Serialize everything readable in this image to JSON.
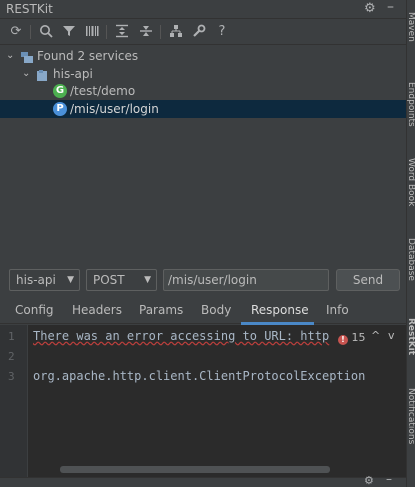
{
  "window": {
    "title": "RESTKit"
  },
  "toolbar": {
    "icons": [
      "refresh-icon",
      "search-icon",
      "filter-icon",
      "barcode-icon",
      "expand-all-icon",
      "collapse-all-icon",
      "sitemap-icon",
      "settings-wrench-icon",
      "help-icon"
    ],
    "help_glyph": "?"
  },
  "tree": {
    "root": {
      "label": "Found 2 services"
    },
    "service": {
      "label": "his-api"
    },
    "endpoints": [
      {
        "method_badge": "G",
        "path": "/test/demo",
        "color": "#4caf50"
      },
      {
        "method_badge": "P",
        "path": "/mis/user/login",
        "color": "#4a90d9"
      }
    ]
  },
  "request": {
    "service_select": "his-api",
    "method_select": "POST",
    "url": "/mis/user/login",
    "send_label": "Send"
  },
  "tabs": [
    {
      "label": "Config",
      "active": false
    },
    {
      "label": "Headers",
      "active": false
    },
    {
      "label": "Params",
      "active": false
    },
    {
      "label": "Body",
      "active": false
    },
    {
      "label": "Response",
      "active": true
    },
    {
      "label": "Info",
      "active": false
    }
  ],
  "editor": {
    "line_numbers": [
      "1",
      "2",
      "3"
    ],
    "lines": [
      "There was an error accessing to URL: http",
      "",
      "org.apache.http.client.ClientProtocolException"
    ],
    "error_count": "15",
    "nav_up": "^",
    "nav_down": "v"
  },
  "right_strip": {
    "labels": [
      "Maven",
      "Endpoints",
      "Word Book",
      "Database",
      "RestKit",
      "Notifications"
    ]
  },
  "colors": {
    "background": "#3c3f41",
    "editor_background": "#2b2b2b",
    "selection": "#0d293e",
    "accent": "#4a88c7",
    "error": "#c75450"
  }
}
